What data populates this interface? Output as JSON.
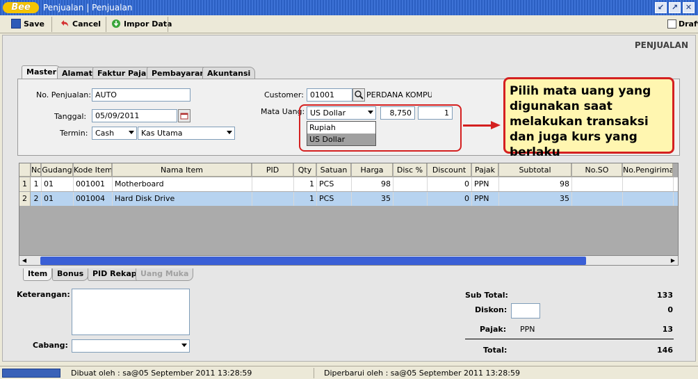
{
  "window": {
    "logo_text": "Bee",
    "title": "Penjualan | Penjualan",
    "controls": {
      "restore": "↙",
      "maximize": "↗",
      "close": "✕"
    }
  },
  "toolbar": {
    "save_label": "Save",
    "cancel_label": "Cancel",
    "import_label": "Impor Data",
    "draft_label": "Draft"
  },
  "page_title": "PENJUALAN",
  "tabs": [
    {
      "label": "Master",
      "active": true
    },
    {
      "label": "Alamat",
      "active": false
    },
    {
      "label": "Faktur Pajak",
      "active": false
    },
    {
      "label": "Pembayaran",
      "active": false
    },
    {
      "label": "Akuntansi",
      "active": false
    }
  ],
  "master": {
    "no_penjualan_label": "No. Penjualan:",
    "no_penjualan_value": "AUTO",
    "tanggal_label": "Tanggal:",
    "tanggal_value": "05/09/2011",
    "termin_label": "Termin:",
    "termin_value": "Cash",
    "kas_value": "Kas Utama",
    "customer_label": "Customer:",
    "customer_code": "01001",
    "customer_name": "PERDANA KOMPUTER",
    "mata_uang_label": "Mata Uang:",
    "mata_uang_value": "US Dollar",
    "kurs_value": "8,750",
    "kurs_unit_value": "1",
    "mata_uang_options": [
      {
        "label": "Rupiah",
        "selected": false
      },
      {
        "label": "US Dollar",
        "selected": true
      }
    ]
  },
  "callout_text": "Pilih mata uang yang digunakan saat melakukan transaksi dan juga kurs yang berlaku",
  "grid": {
    "columns": [
      "No",
      "Gudang",
      "Kode Item",
      "Nama Item",
      "PID",
      "Qty",
      "Satuan",
      "Harga",
      "Disc %",
      "Discount",
      "Pajak",
      "Subtotal",
      "No.SO",
      "No.Pengiriman"
    ],
    "rows": [
      {
        "row_no": "1",
        "cells": [
          "1",
          "01",
          "001001",
          "Motherboard",
          "",
          "1",
          "PCS",
          "98",
          "",
          "0",
          "PPN",
          "98",
          "",
          ""
        ],
        "selected": false
      },
      {
        "row_no": "2",
        "cells": [
          "2",
          "01",
          "001004",
          "Hard Disk Drive",
          "",
          "1",
          "PCS",
          "35",
          "",
          "0",
          "PPN",
          "35",
          "",
          ""
        ],
        "selected": true
      }
    ]
  },
  "bottom_tabs": [
    {
      "label": "Item",
      "state": "active"
    },
    {
      "label": "Bonus",
      "state": "normal"
    },
    {
      "label": "PID Rekap",
      "state": "normal"
    },
    {
      "label": "Uang Muka",
      "state": "disabled"
    }
  ],
  "footer": {
    "keterangan_label": "Keterangan:",
    "cabang_label": "Cabang:",
    "cabang_value": ""
  },
  "summary": {
    "subtotal_label": "Sub Total:",
    "subtotal_value": "133",
    "diskon_label": "Diskon:",
    "diskon_value": "0",
    "pajak_label": "Pajak:",
    "pajak_type": "PPN",
    "pajak_value": "13",
    "total_label": "Total:",
    "total_value": "146"
  },
  "status": {
    "created": "Dibuat oleh : sa@05 September 2011  13:28:59",
    "updated": "Diperbarui oleh : sa@05 September 2011  13:28:59"
  },
  "colors": {
    "titlebar": "#3d72d6",
    "selected_row": "#b7d3f0",
    "annotation": "#d42020",
    "callout_bg": "#fff6b0"
  }
}
